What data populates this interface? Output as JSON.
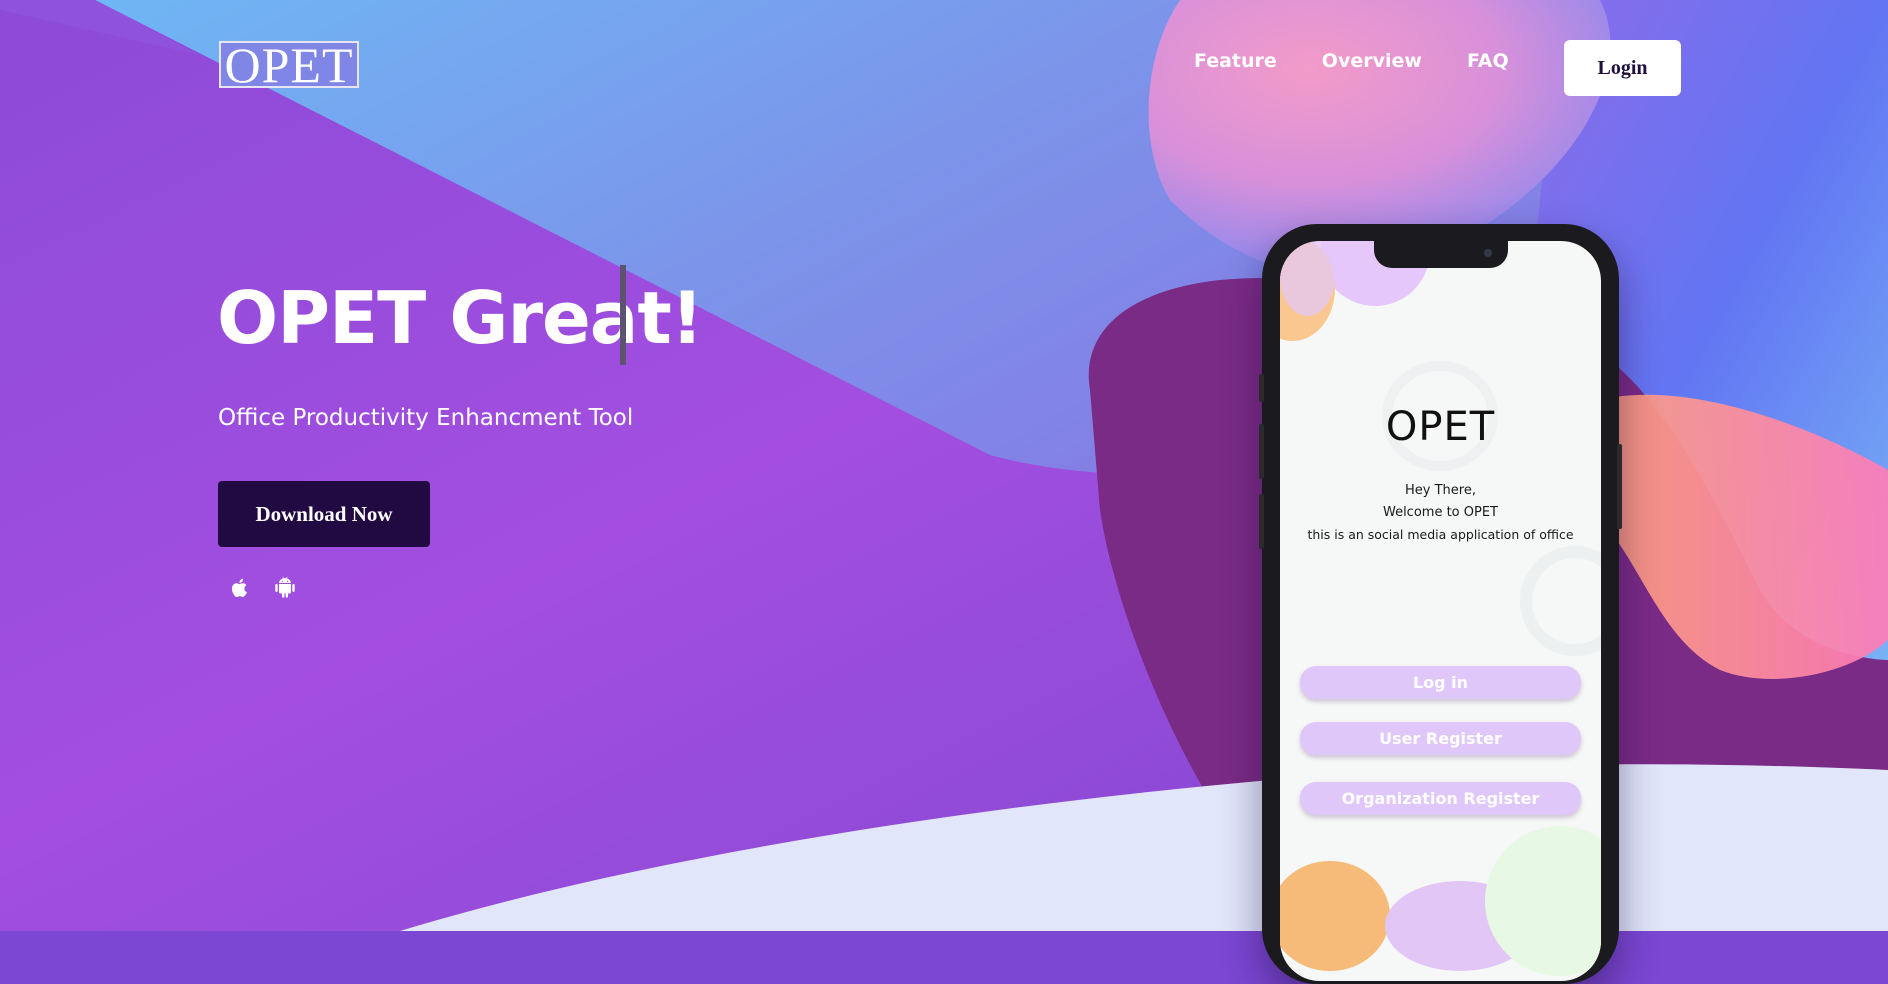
{
  "header": {
    "logo_text": "OPET",
    "nav": [
      {
        "label": "Feature"
      },
      {
        "label": "Overview"
      },
      {
        "label": "FAQ"
      }
    ],
    "login_label": "Login"
  },
  "hero": {
    "title": "OPET Great!",
    "subtitle": "Office Productivity Enhancment Tool",
    "download_label": "Download Now",
    "platform_icons": [
      "apple-icon",
      "android-icon"
    ]
  },
  "phone": {
    "app_logo": "OPET",
    "greeting_line1": "Hey There,",
    "greeting_line2": "Welcome to OPET",
    "greeting_line3": "this is an social media application of office",
    "buttons": [
      {
        "label": "Log in"
      },
      {
        "label": "User Register"
      },
      {
        "label": "Organization Register"
      }
    ]
  },
  "colors": {
    "background_purple": "#9a4ee0",
    "background_blue": "#7aa3ee",
    "dark_purple_blob": "#7a2b86",
    "download_button": "#200a41",
    "app_button": "#e0c7f9",
    "floor": "#e1e6fb"
  }
}
